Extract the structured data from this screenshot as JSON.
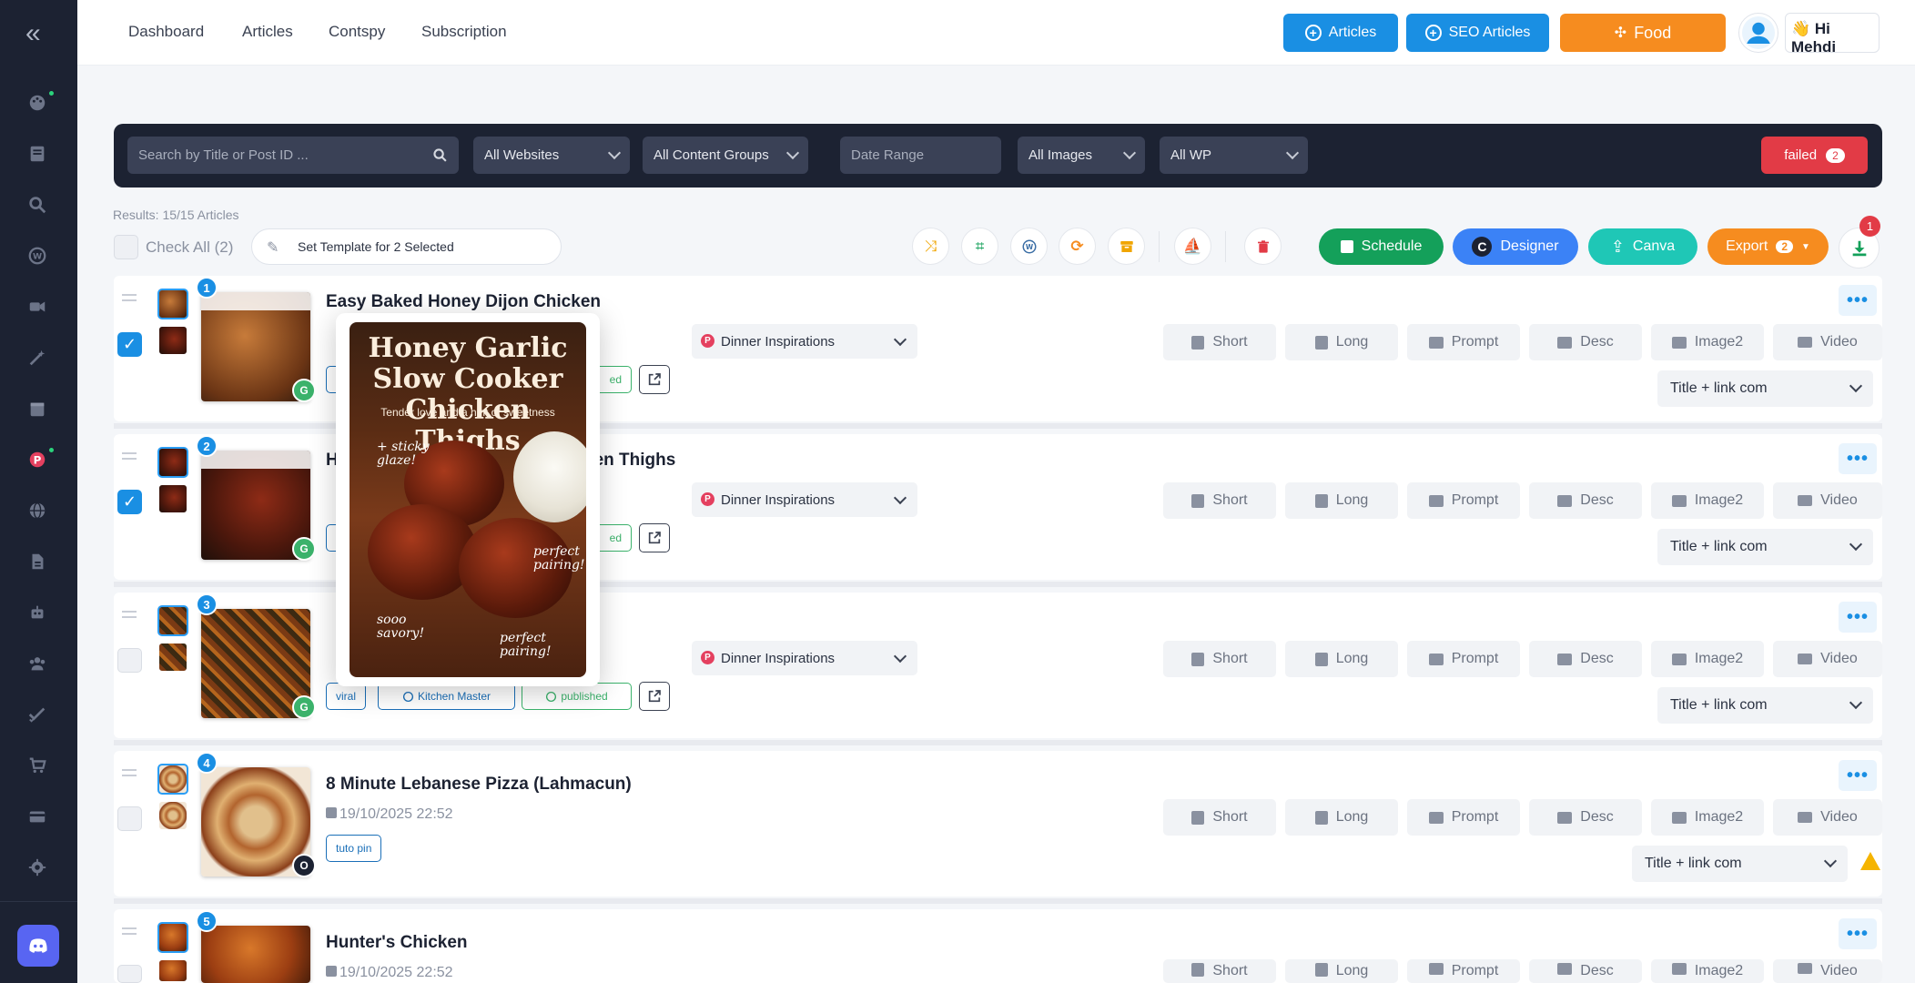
{
  "topnav": {
    "links": [
      "Dashboard",
      "Articles",
      "Contspy",
      "Subscription"
    ],
    "btn_articles": "Articles",
    "btn_seo": "SEO Articles",
    "btn_food": "Food",
    "greeting": "👋 Hi Mehdi"
  },
  "filters": {
    "search_placeholder": "Search by Title or Post ID ...",
    "websites": "All Websites",
    "content_groups": "All Content Groups",
    "date_placeholder": "Date Range",
    "images": "All Images",
    "wp": "All WP",
    "failed_label": "failed",
    "failed_count": "2"
  },
  "toolbar": {
    "results": "Results: 15/15 Articles",
    "check_all": "Check All (2)",
    "set_template": "Set Template for 2 Selected",
    "schedule": "Schedule",
    "designer": "Designer",
    "canva": "Canva",
    "export": "Export",
    "export_count": "2",
    "download_count": "1"
  },
  "actions": [
    "Short",
    "Long",
    "Prompt",
    "Desc",
    "Image2",
    "Video"
  ],
  "rows": [
    {
      "num": "1",
      "title": "Easy Baked Honey Dijon Chicken",
      "board": "Dinner Inspirations",
      "template": "Title + link com",
      "status": "G",
      "checked": true
    },
    {
      "num": "2",
      "title": "Honey Garlic Slow Cooker Chicken Thighs",
      "board": "Dinner Inspirations",
      "template": "Title + link com",
      "status": "G",
      "checked": true
    },
    {
      "num": "3",
      "title": "",
      "board": "Dinner Inspirations",
      "template": "Title + link com",
      "status": "G",
      "checked": false,
      "tags": [
        "viral",
        "Kitchen Master",
        "published"
      ]
    },
    {
      "num": "4",
      "title": "8 Minute Lebanese Pizza (Lahmacun)",
      "date": "19/10/2025 22:52",
      "template": "Title + link com",
      "status": "O",
      "checked": false,
      "tags": [
        "tuto pin"
      ]
    },
    {
      "num": "5",
      "title": "Hunter's Chicken",
      "date": "19/10/2025 22:52",
      "checked": false
    }
  ],
  "row_fragments": {
    "tag_published_partial": "ed"
  },
  "preview": {
    "title": "Honey Garlic Slow Cooker Chicken Thighs",
    "subtitle": "Tender love and a hint of sweetness",
    "note_glaze": "+ sticky glaze!",
    "note_pairing": "perfect pairing!",
    "note_savory": "sooo savory!",
    "note_pairing2": "perfect pairing!"
  },
  "colors": {
    "sidebar": "#1c2232",
    "blue": "#1a8fe3",
    "orange": "#f68c1f",
    "red": "#e23b46",
    "green": "#14a05a",
    "teal": "#1fc7b6",
    "designer": "#3b82f6"
  }
}
